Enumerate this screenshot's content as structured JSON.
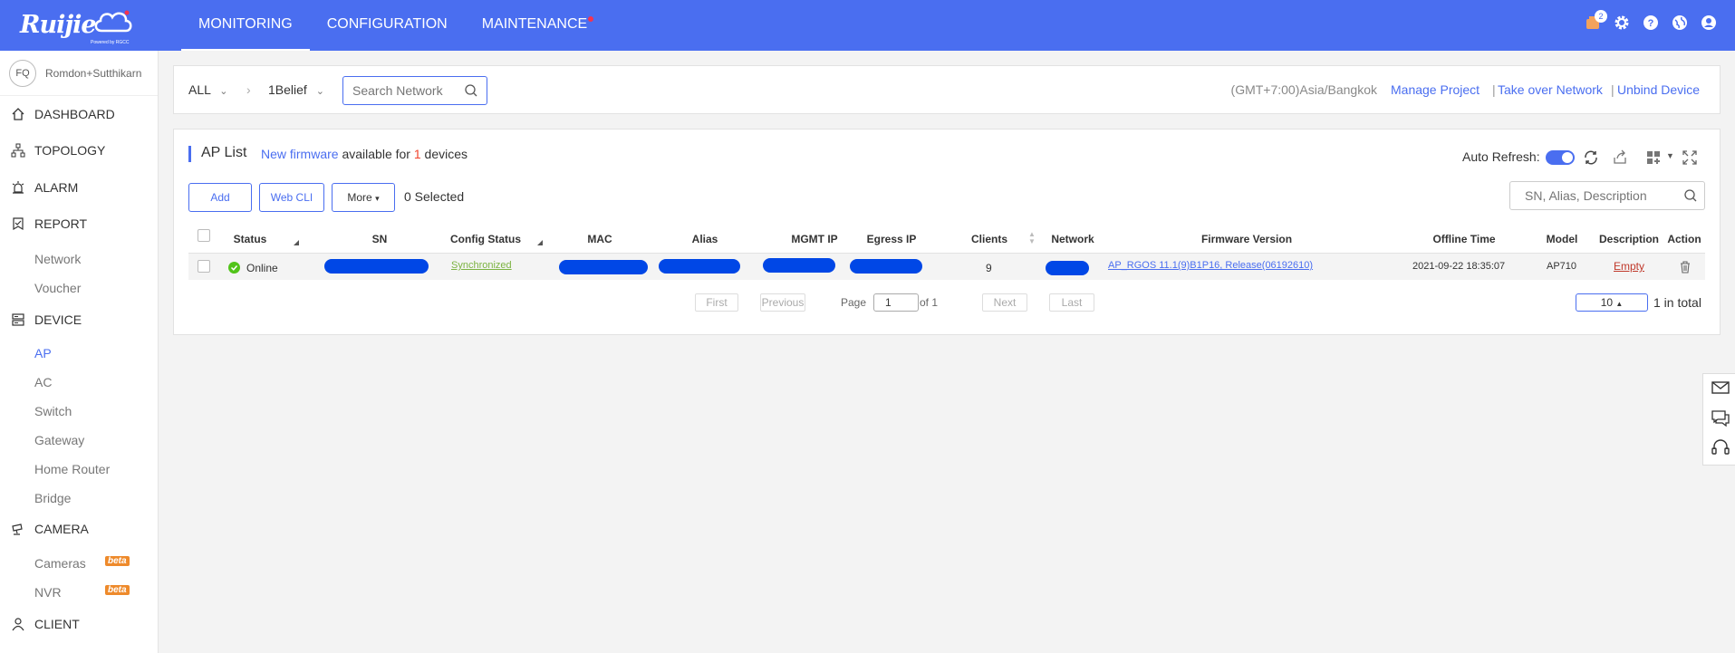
{
  "brand": {
    "name": "Ruijie",
    "powered": "Powered by RGCC"
  },
  "nav": {
    "monitoring": "MONITORING",
    "configuration": "CONFIGURATION",
    "maintenance": "MAINTENANCE"
  },
  "topbar": {
    "notification_count": "2"
  },
  "sidebar": {
    "avatar_initials": "FQ",
    "user": "Romdon+Sutthikarn",
    "dashboard": "DASHBOARD",
    "topology": "TOPOLOGY",
    "alarm": "ALARM",
    "report": "REPORT",
    "report_network": "Network",
    "report_voucher": "Voucher",
    "device": "DEVICE",
    "device_ap": "AP",
    "device_ac": "AC",
    "device_switch": "Switch",
    "device_gateway": "Gateway",
    "device_home_router": "Home Router",
    "device_bridge": "Bridge",
    "camera": "CAMERA",
    "camera_cameras": "Cameras",
    "camera_nvr": "NVR",
    "beta": "beta",
    "client": "CLIENT"
  },
  "header": {
    "scope": "ALL",
    "network": "1Belief",
    "search_placeholder": "Search Network",
    "timezone": "(GMT+7:00)Asia/Bangkok",
    "manage_project": "Manage Project",
    "take_over": "Take over Network",
    "unbind": "Unbind Device"
  },
  "ap_list": {
    "title": "AP List",
    "fw_link": "New firmware",
    "fw_text1": " available for ",
    "fw_count": "1",
    "fw_text2": " devices",
    "add": "Add",
    "web_cli": "Web CLI",
    "more": "More",
    "selected": "0 Selected",
    "auto_refresh": "Auto Refresh:",
    "search_placeholder": "SN, Alias, Description"
  },
  "table": {
    "headers": {
      "status": "Status",
      "sn": "SN",
      "config_status": "Config Status",
      "mac": "MAC",
      "alias": "Alias",
      "mgmt_ip": "MGMT IP",
      "egress_ip": "Egress IP",
      "clients": "Clients",
      "network": "Network",
      "firmware": "Firmware Version",
      "offline_time": "Offline Time",
      "model": "Model",
      "description": "Description",
      "action": "Action"
    },
    "rows": [
      {
        "status": "Online",
        "config_status": "Synchronized",
        "clients": "9",
        "firmware": "AP_RGOS 11.1(9)B1P16, Release(06192610)",
        "offline_time": "2021-09-22 18:35:07",
        "model": "AP710",
        "description": "Empty"
      }
    ]
  },
  "pager": {
    "first": "First",
    "previous": "Previous",
    "page": "Page",
    "current": "1",
    "of": "of 1",
    "next": "Next",
    "last": "Last",
    "page_size": "10",
    "total": "1 in total"
  },
  "colors": {
    "primary": "#4a6ef0",
    "online": "#52c41a",
    "sync": "#7cb342",
    "empty": "#c0392b",
    "fw_count": "#f0442c"
  }
}
